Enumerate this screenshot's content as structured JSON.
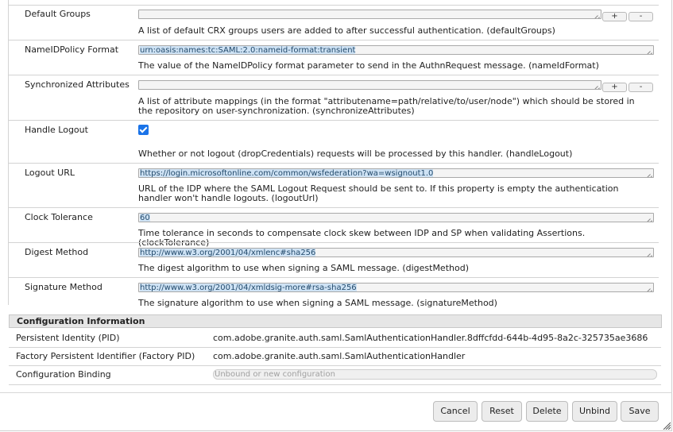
{
  "properties": [
    {
      "label": "Default Groups",
      "value": "",
      "description": "A list of default CRX groups users are added to after successful authentication. (defaultGroups)",
      "multivalue": true
    },
    {
      "label": "NameIDPolicy Format",
      "value": "urn:oasis:names:tc:SAML:2.0:nameid-format:transient",
      "description": "The value of the NameIDPolicy format parameter to send in the AuthnRequest message. (nameIdFormat)"
    },
    {
      "label": "Synchronized Attributes",
      "value": "",
      "description": "A list of attribute mappings (in the format \"attributename=path/relative/to/user/node\") which should be stored in the repository on user-synchronization. (synchronizeAttributes)",
      "multivalue": true
    },
    {
      "label": "Handle Logout",
      "checked": true,
      "description": "Whether or not logout (dropCredentials) requests will be processed by this handler. (handleLogout)"
    },
    {
      "label": "Logout URL",
      "value": "https://login.microsoftonline.com/common/wsfederation?wa=wsignout1.0",
      "description": "URL of the IDP where the SAML Logout Request should be sent to. If this property is empty the authentication handler won't handle logouts. (logoutUrl)"
    },
    {
      "label": "Clock Tolerance",
      "value": "60",
      "description": "Time tolerance in seconds to compensate clock skew between IDP and SP when validating Assertions. (clockTolerance)"
    },
    {
      "label": "Digest Method",
      "value": "http://www.w3.org/2001/04/xmlenc#sha256",
      "description": "The digest algorithm to use when signing a SAML message. (digestMethod)"
    },
    {
      "label": "Signature Method",
      "value": "http://www.w3.org/2001/04/xmldsig-more#rsa-sha256",
      "description": "The signature algorithm to use when signing a SAML message. (signatureMethod)"
    }
  ],
  "add_label": "+",
  "remove_label": "-",
  "config_info": {
    "title": "Configuration Information",
    "rows": [
      {
        "label": "Persistent Identity (PID)",
        "value": "com.adobe.granite.auth.saml.SamlAuthenticationHandler.8dffcfdd-644b-4d95-8a2c-325735ae3686"
      },
      {
        "label": "Factory Persistent Identifier (Factory PID)",
        "value": "com.adobe.granite.auth.saml.SamlAuthenticationHandler"
      },
      {
        "label": "Configuration Binding",
        "placeholder": "Unbound or new configuration"
      }
    ]
  },
  "buttons": {
    "cancel": "Cancel",
    "reset": "Reset",
    "delete": "Delete",
    "unbind": "Unbind",
    "save": "Save"
  }
}
